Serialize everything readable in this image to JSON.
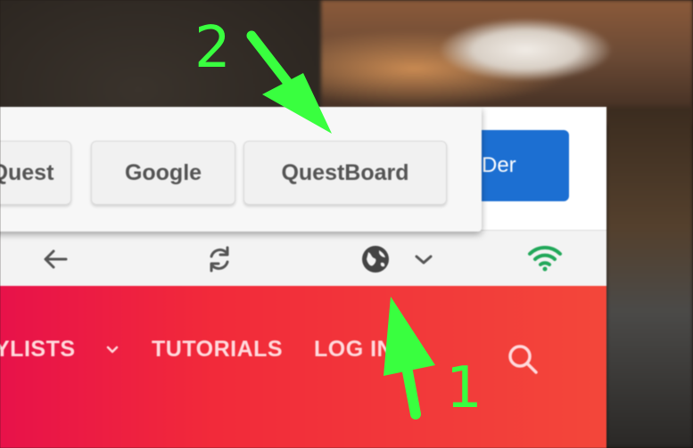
{
  "search_engine_popup": {
    "engines": [
      {
        "label": "Quest"
      },
      {
        "label": "Google"
      },
      {
        "label": "QuestBoard"
      }
    ]
  },
  "background_button": {
    "label": "Der"
  },
  "toolbar": {
    "icons": [
      "back-arrow-icon",
      "refresh-icon",
      "globe-icon",
      "chevron-down-icon",
      "wifi-icon"
    ]
  },
  "nav": {
    "items": [
      {
        "label": "YLISTS"
      },
      {
        "label": "TUTORIALS"
      },
      {
        "label": "LOG IN"
      }
    ],
    "icons": [
      "chevron-down-icon",
      "search-icon"
    ]
  },
  "annotations": [
    {
      "label": "1"
    },
    {
      "label": "2"
    }
  ],
  "colors": {
    "annotation_green": "#39ff3f",
    "nav_red": "#f22a3a",
    "accent_blue": "#1c6fd2",
    "wifi_green": "#22a85a"
  }
}
